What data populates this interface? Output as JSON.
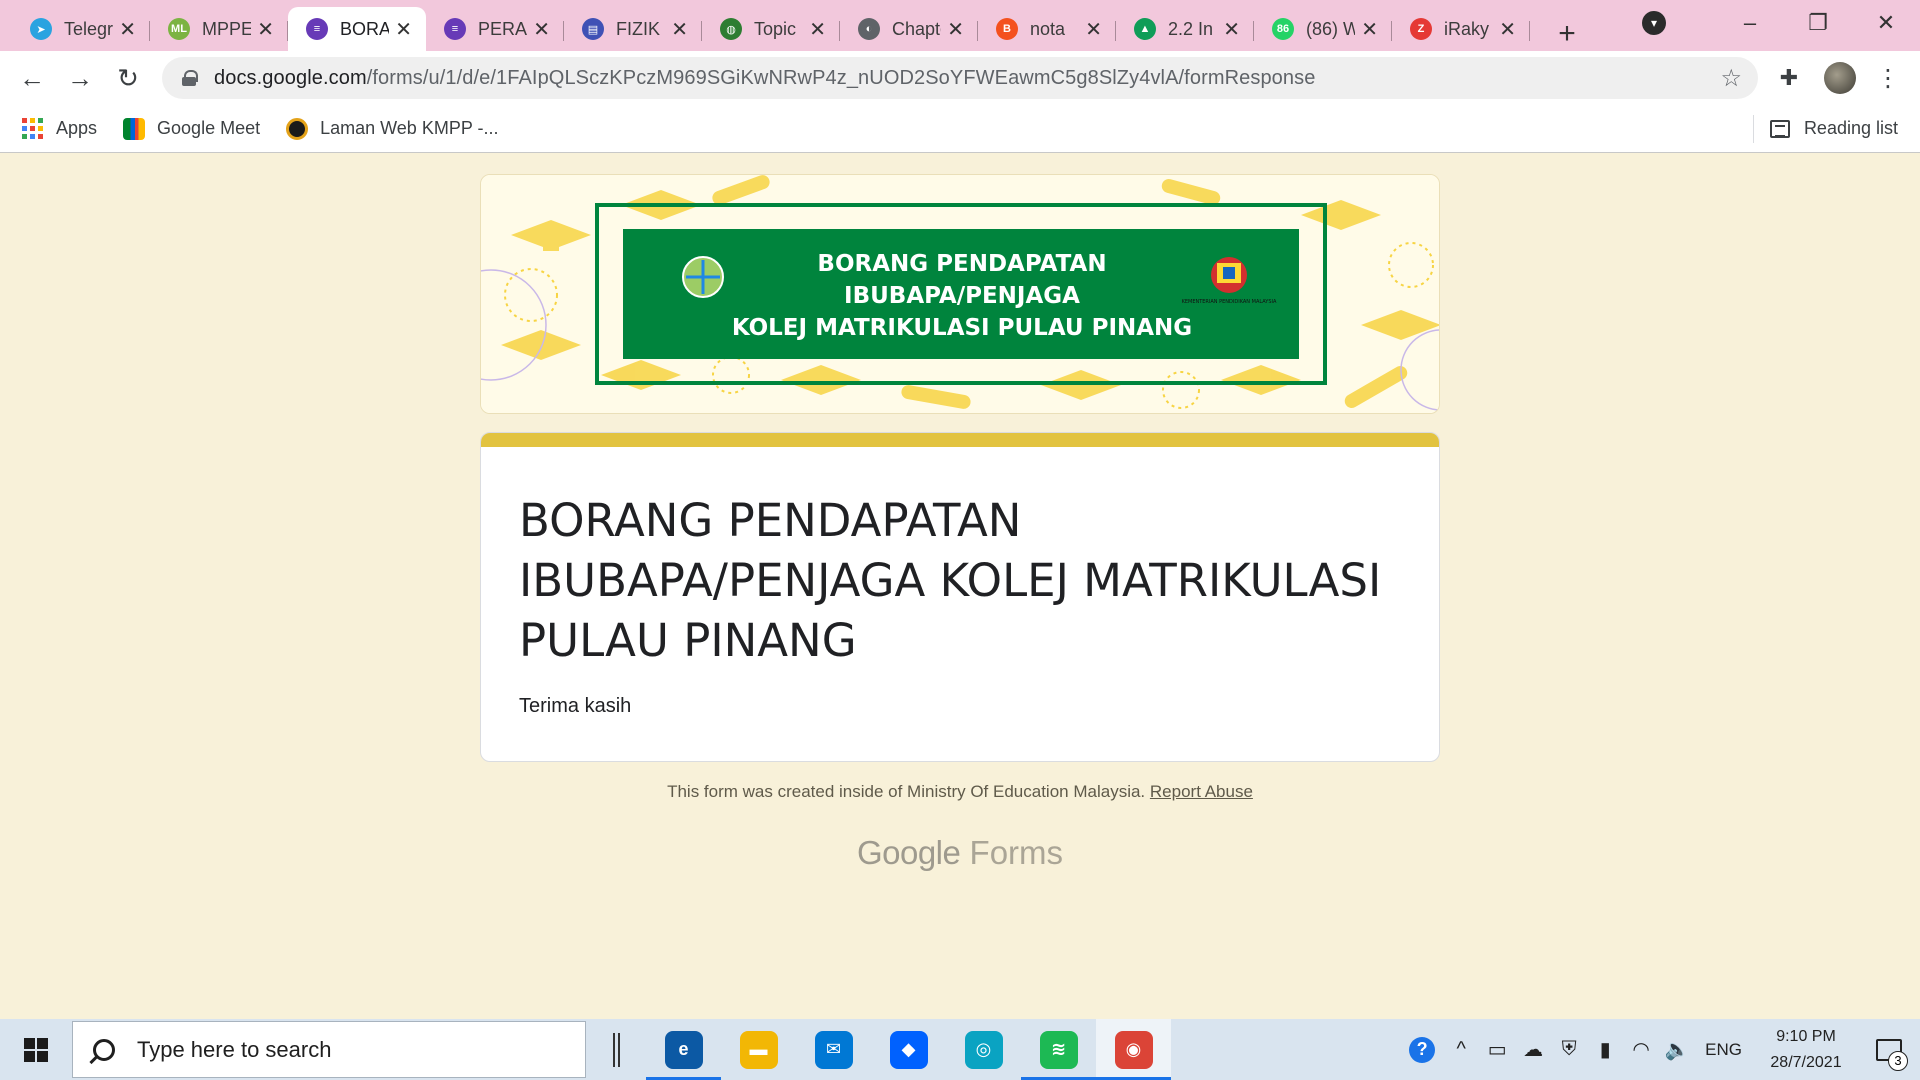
{
  "browser": {
    "tabs": [
      {
        "title": "Telegram",
        "icon": "telegram-icon",
        "color": "#2aa3e0",
        "glyph": "➤"
      },
      {
        "title": "MPPE",
        "icon": "ml-logo-icon",
        "color": "#7cb342",
        "glyph": "ML"
      },
      {
        "title": "BORANG PENDAPATAN",
        "icon": "google-forms-icon",
        "color": "#673ab7",
        "glyph": "≡",
        "active": true
      },
      {
        "title": "PERANCANGAN",
        "icon": "google-forms-icon",
        "color": "#673ab7",
        "glyph": "≡"
      },
      {
        "title": "FIZIK",
        "icon": "form-icon",
        "color": "#3f51b5",
        "glyph": "▤"
      },
      {
        "title": "Topic",
        "icon": "globe-icon",
        "color": "#2e7d32",
        "glyph": "◍"
      },
      {
        "title": "Chapter",
        "icon": "web-globe-icon",
        "color": "#5f6368",
        "glyph": "◐"
      },
      {
        "title": "nota",
        "icon": "blogger-icon",
        "color": "#f4511e",
        "glyph": "B"
      },
      {
        "title": "2.2 In",
        "icon": "google-drive-icon",
        "color": "#0f9d58",
        "glyph": "▲"
      },
      {
        "title": "(86) W",
        "icon": "whatsapp-icon",
        "color": "#25d366",
        "glyph": "86"
      },
      {
        "title": "iRaky",
        "icon": "iraky-icon",
        "color": "#e53935",
        "glyph": "Z"
      }
    ],
    "url_host": "docs.google.com",
    "url_path": "/forms/u/1/d/e/1FAIpQLSczKPczM969SGiKwNRwP4z_nUOD2SoYFWEawmC5g8SlZy4vlA/formResponse",
    "bookmarks": [
      {
        "label": "Apps",
        "icon": "apps-grid-icon"
      },
      {
        "label": "Google Meet",
        "icon": "google-meet-icon"
      },
      {
        "label": "Laman Web KMPP -...",
        "icon": "kmpp-logo-icon"
      }
    ],
    "reading_list": "Reading list"
  },
  "form": {
    "banner_lines": [
      "BORANG PENDAPATAN",
      "IBUBAPA/PENJAGA",
      "KOLEJ MATRIKULASI PULAU PINANG"
    ],
    "banner_ministry": "KEMENTERIAN PENDIDIKAN MALAYSIA",
    "title": "BORANG PENDAPATAN IBUBAPA/PENJAGA KOLEJ MATRIKULASI PULAU PINANG",
    "description": "Terima kasih",
    "footer_text": "This form was created inside of Ministry Of Education Malaysia.",
    "footer_link": "Report Abuse",
    "brand_google": "Google",
    "brand_forms": "Forms",
    "accent_color": "#e2c340",
    "background_color": "#f8f1d9",
    "banner_green": "#00843d"
  },
  "taskbar": {
    "search_placeholder": "Type here to search",
    "apps": [
      {
        "name": "edge-icon",
        "color": "#0c59a4",
        "glyph": "e"
      },
      {
        "name": "file-explorer-icon",
        "color": "#f2b705",
        "glyph": "▬"
      },
      {
        "name": "mail-icon",
        "color": "#0078d4",
        "glyph": "✉"
      },
      {
        "name": "dropbox-icon",
        "color": "#0061fe",
        "glyph": "◆"
      },
      {
        "name": "app-store-icon",
        "color": "#0aa3c2",
        "glyph": "◎"
      },
      {
        "name": "spotify-icon",
        "color": "#1db954",
        "glyph": "≋"
      },
      {
        "name": "chrome-icon",
        "color": "#db4437",
        "glyph": "◉"
      }
    ],
    "language": "ENG",
    "time": "9:10 PM",
    "date": "28/7/2021",
    "notification_count": "3"
  }
}
